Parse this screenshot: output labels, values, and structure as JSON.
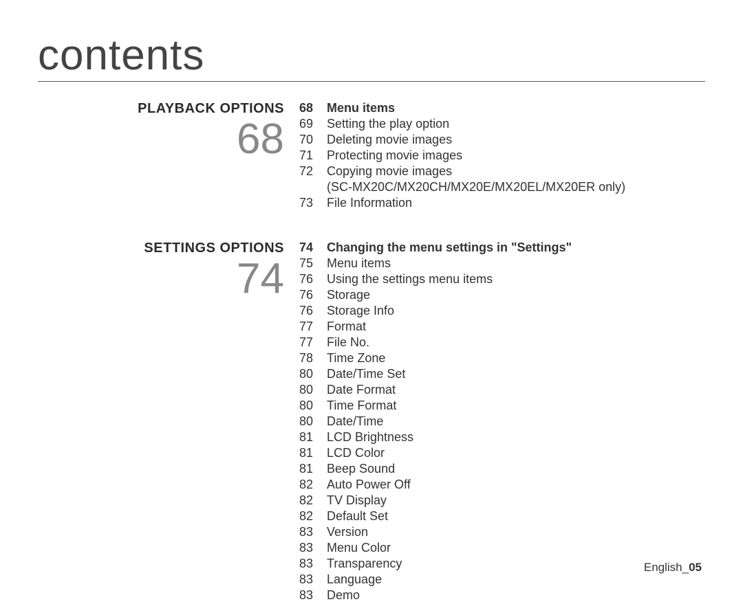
{
  "heading": "contents",
  "sections": [
    {
      "title": "PLAYBACK OPTIONS",
      "page": "68",
      "entries": [
        {
          "page": "68",
          "text": "Menu items",
          "bold": true
        },
        {
          "page": "69",
          "text": "Setting the play option"
        },
        {
          "page": "70",
          "text": "Deleting movie images"
        },
        {
          "page": "71",
          "text": "Protecting movie images"
        },
        {
          "page": "72",
          "text": "Copying movie images"
        },
        {
          "note": "(SC-MX20C/MX20CH/MX20E/MX20EL/MX20ER only)"
        },
        {
          "page": "73",
          "text": "File Information"
        }
      ]
    },
    {
      "title": "SETTINGS OPTIONS",
      "page": "74",
      "entries": [
        {
          "page": "74",
          "text": "Changing the menu settings in \"Settings\"",
          "bold": true
        },
        {
          "page": "75",
          "text": "Menu items"
        },
        {
          "page": "76",
          "text": "Using the settings menu items"
        },
        {
          "page": "76",
          "text": "Storage"
        },
        {
          "page": "76",
          "text": "Storage Info"
        },
        {
          "page": "77",
          "text": "Format"
        },
        {
          "page": "77",
          "text": "File No."
        },
        {
          "page": "78",
          "text": "Time Zone"
        },
        {
          "page": "80",
          "text": "Date/Time Set"
        },
        {
          "page": "80",
          "text": "Date Format"
        },
        {
          "page": "80",
          "text": "Time Format"
        },
        {
          "page": "80",
          "text": "Date/Time"
        },
        {
          "page": "81",
          "text": "LCD Brightness"
        },
        {
          "page": "81",
          "text": "LCD Color"
        },
        {
          "page": "81",
          "text": "Beep Sound"
        },
        {
          "page": "82",
          "text": "Auto Power Off"
        },
        {
          "page": "82",
          "text": "TV Display"
        },
        {
          "page": "82",
          "text": "Default Set"
        },
        {
          "page": "83",
          "text": "Version"
        },
        {
          "page": "83",
          "text": "Menu Color"
        },
        {
          "page": "83",
          "text": "Transparency"
        },
        {
          "page": "83",
          "text": "Language"
        },
        {
          "page": "83",
          "text": "Demo"
        }
      ]
    }
  ],
  "footer": {
    "label": "English_",
    "num": "05"
  }
}
